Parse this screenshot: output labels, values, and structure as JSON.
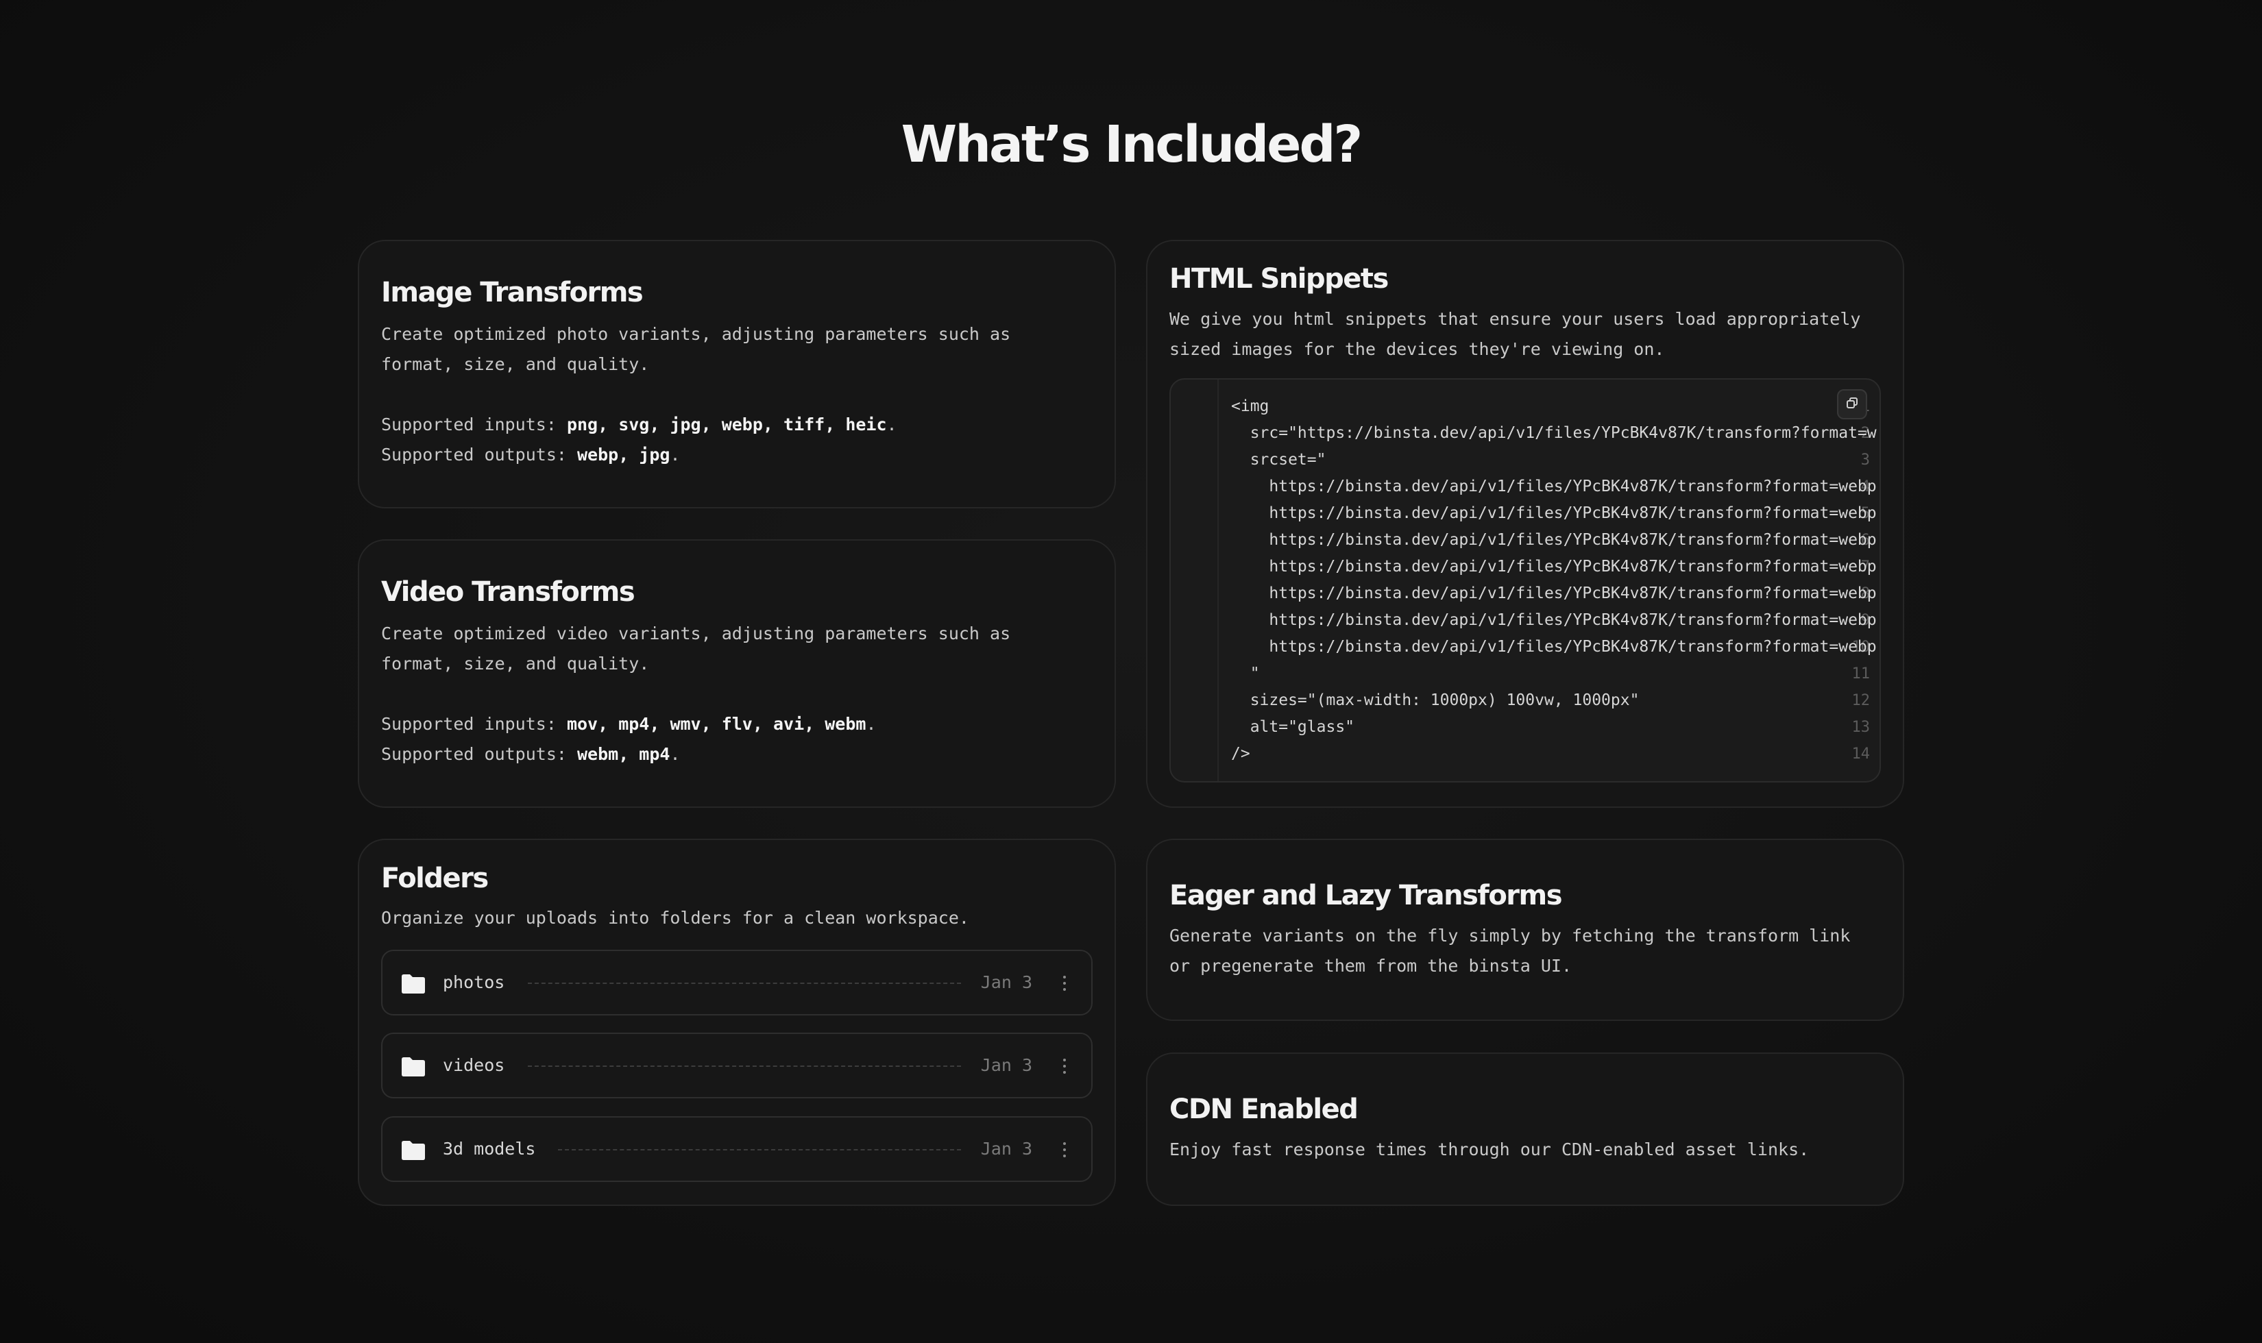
{
  "page": {
    "title": "What’s Included?"
  },
  "image_transforms": {
    "title": "Image Transforms",
    "desc": "Create optimized photo variants, adjusting parameters such as format, size, and quality.",
    "inputs_label": "Supported inputs: ",
    "inputs": "png, svg, jpg, webp, tiff, heic",
    "outputs_label": "Supported outputs: ",
    "outputs": "webp, jpg"
  },
  "video_transforms": {
    "title": "Video Transforms",
    "desc": "Create optimized video variants, adjusting parameters such as format, size, and quality.",
    "inputs_label": "Supported inputs: ",
    "inputs": "mov, mp4, wmv, flv, avi, webm",
    "outputs_label": "Supported outputs: ",
    "outputs": "webm, mp4"
  },
  "folders": {
    "title": "Folders",
    "desc": "Organize your uploads into folders for a clean workspace.",
    "items": [
      {
        "name": "photos",
        "date": "Jan 3"
      },
      {
        "name": "videos",
        "date": "Jan 3"
      },
      {
        "name": "3d models",
        "date": "Jan 3"
      }
    ]
  },
  "html_snippets": {
    "title": "HTML Snippets",
    "desc": "We give you html snippets that ensure your users load appropriately sized images for the devices they're viewing on.",
    "code_lines": [
      "<img",
      "  src=\"https://binsta.dev/api/v1/files/YPcBK4v87K/transform?format=w",
      "  srcset=\"",
      "    https://binsta.dev/api/v1/files/YPcBK4v87K/transform?format=webp",
      "    https://binsta.dev/api/v1/files/YPcBK4v87K/transform?format=webp",
      "    https://binsta.dev/api/v1/files/YPcBK4v87K/transform?format=webp",
      "    https://binsta.dev/api/v1/files/YPcBK4v87K/transform?format=webp",
      "    https://binsta.dev/api/v1/files/YPcBK4v87K/transform?format=webp",
      "    https://binsta.dev/api/v1/files/YPcBK4v87K/transform?format=webp",
      "    https://binsta.dev/api/v1/files/YPcBK4v87K/transform?format=webp",
      "  \"",
      "  sizes=\"(max-width: 1000px) 100vw, 1000px\"",
      "  alt=\"glass\"",
      "/>"
    ],
    "line_numbers": [
      "1",
      "2",
      "3",
      "4",
      "5",
      "6",
      "7",
      "8",
      "9",
      "10",
      "11",
      "12",
      "13",
      "14"
    ]
  },
  "eager_lazy": {
    "title": "Eager and Lazy Transforms",
    "desc": "Generate variants on the fly simply by fetching the transform link or pregenerate them from the binsta UI."
  },
  "cdn": {
    "title": "CDN Enabled",
    "desc": "Enjoy fast response times through our CDN-enabled asset links."
  },
  "icons": {
    "folder": "folder-icon",
    "copy": "copy-icon",
    "more": "more-vertical-icon"
  }
}
